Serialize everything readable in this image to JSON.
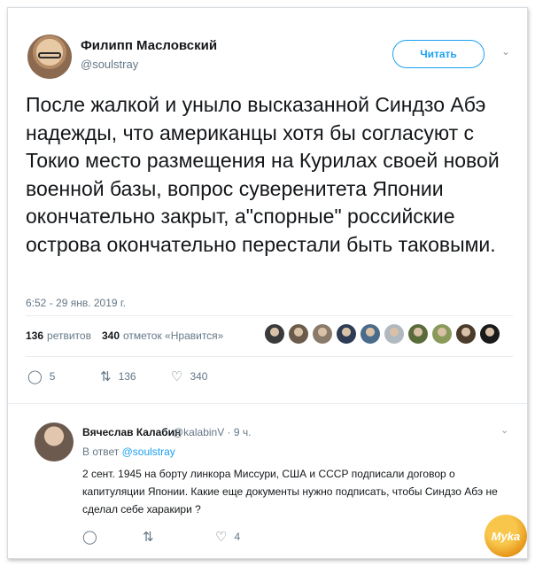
{
  "tweet": {
    "author_name": "Филипп Масловский",
    "author_handle": "@soulstray",
    "follow_label": "Читать",
    "text": "После жалкой и уныло высказанной Синдзо Абэ надежды, что американцы хотя бы согласуют с Токио место размещения на Курилах своей новой военной базы, вопрос суверенитета Японии окончательно закрыт, а\"спорные\" российские острова окончательно перестали быть таковыми.",
    "timestamp": "6:52 - 29 янв. 2019 г.",
    "retweets_count": "136",
    "retweets_label": "ретвитов",
    "likes_count": "340",
    "likes_label": "отметок «Нравится»",
    "liker_colors": [
      "#3a3a3a",
      "#6b5b4a",
      "#8a7a6a",
      "#2d3b55",
      "#4a6b8a",
      "#b0b8c0",
      "#5a6b3a",
      "#8a9a5a",
      "#4a3b2a",
      "#1a1a1a"
    ],
    "actions": {
      "replies": "5",
      "retweets": "136",
      "likes": "340"
    }
  },
  "reply": {
    "author_name": "Вячеслав Калабин",
    "meta": "@kalabinV · 9 ч.",
    "reply_to_prefix": "В ответ",
    "reply_to_handle": "@soulstray",
    "text": "2 сент. 1945 на борту линкора Миссури, США и СССР подписали договор о капитуляции Японии. Какие еще документы нужно подписать, чтобы Синдзо Абэ не сделал себе харакири ?",
    "actions": {
      "likes": "4"
    }
  },
  "watermark": "Myka"
}
